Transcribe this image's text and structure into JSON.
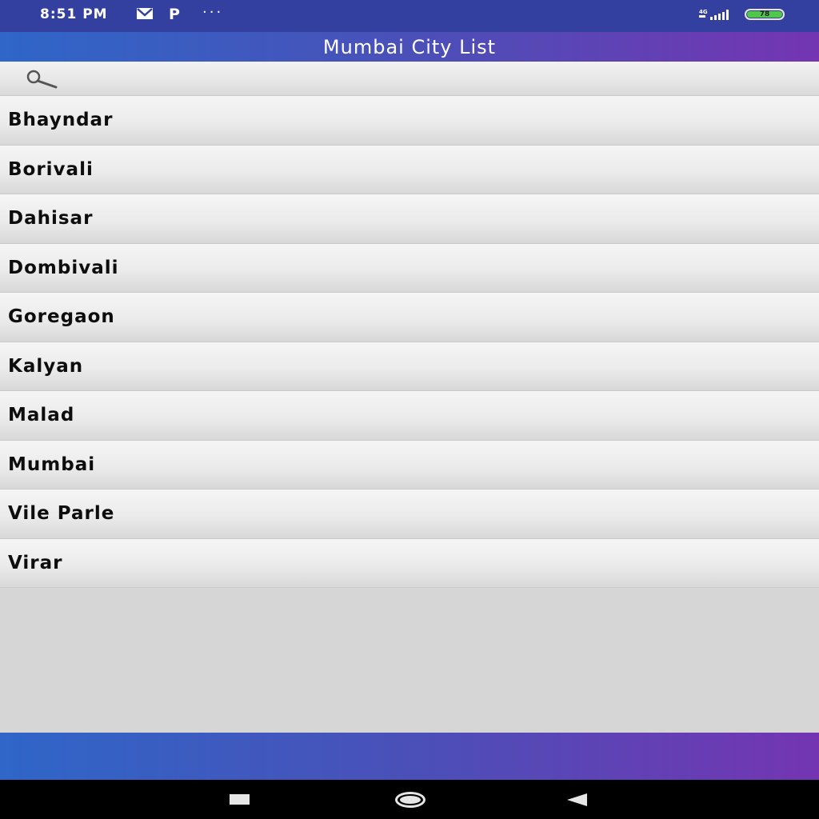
{
  "status_bar": {
    "time": "8:51 PM",
    "icons": [
      "mail-icon",
      "p-icon",
      "more-dots-icon",
      "signal-4g-icon"
    ],
    "p_glyph": "P",
    "dots": "···",
    "network": "4G",
    "battery": "78"
  },
  "app_bar": {
    "title": "Mumbai City List"
  },
  "search": {
    "icon": "search-icon",
    "value": "",
    "placeholder": ""
  },
  "cities": [
    "Bhayndar",
    "Borivali",
    "Dahisar",
    "Dombivali",
    "Goregaon",
    "Kalyan",
    "Malad",
    "Mumbai",
    "Vile Parle",
    "Virar"
  ],
  "nav_bar": {
    "icons": [
      "recent-apps-icon",
      "home-icon",
      "back-icon"
    ]
  },
  "colors": {
    "status_bar": "#3340a0",
    "gradient_start": "#2f66c8",
    "gradient_end": "#7435b2",
    "battery": "#4fc74a",
    "background": "#d6d6d6"
  }
}
